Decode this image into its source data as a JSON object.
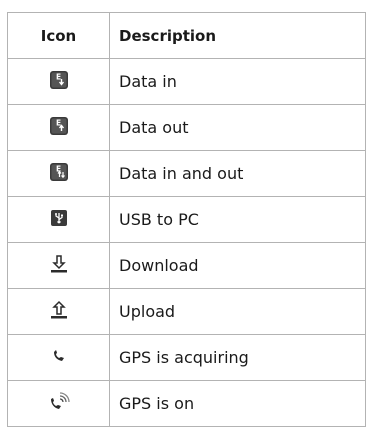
{
  "table": {
    "headers": {
      "icon": "Icon",
      "description": "Description"
    },
    "rows": [
      {
        "icon": "data-in-icon",
        "description": "Data in"
      },
      {
        "icon": "data-out-icon",
        "description": "Data out"
      },
      {
        "icon": "data-in-out-icon",
        "description": "Data in and out"
      },
      {
        "icon": "usb-to-pc-icon",
        "description": "USB to PC"
      },
      {
        "icon": "download-icon",
        "description": "Download"
      },
      {
        "icon": "upload-icon",
        "description": "Upload"
      },
      {
        "icon": "gps-acquiring-icon",
        "description": "GPS is acquiring"
      },
      {
        "icon": "gps-on-icon",
        "description": "GPS is on"
      }
    ]
  }
}
